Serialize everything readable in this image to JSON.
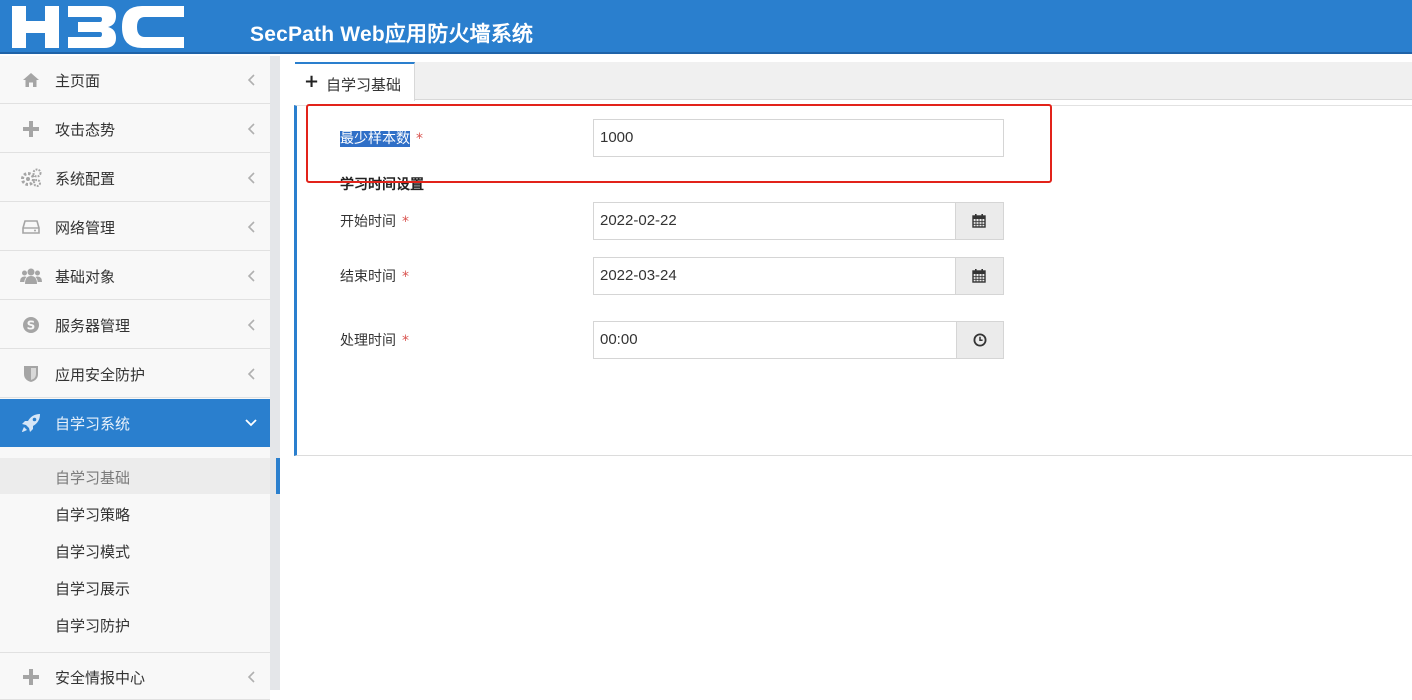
{
  "header": {
    "brand": "H3C",
    "title": "SecPath Web应用防火墙系统"
  },
  "sidebar": {
    "items": [
      {
        "label": "主页面",
        "icon": "home-icon"
      },
      {
        "label": "攻击态势",
        "icon": "plus-icon"
      },
      {
        "label": "系统配置",
        "icon": "gears-icon"
      },
      {
        "label": "网络管理",
        "icon": "hdd-icon"
      },
      {
        "label": "基础对象",
        "icon": "users-icon"
      },
      {
        "label": "服务器管理",
        "icon": "skype-icon"
      },
      {
        "label": "应用安全防护",
        "icon": "shield-icon"
      },
      {
        "label": "自学习系统",
        "icon": "rocket-icon"
      },
      {
        "label": "安全情报中心",
        "icon": "plus-icon"
      }
    ],
    "submenu": [
      "自学习基础",
      "自学习策略",
      "自学习模式",
      "自学习展示",
      "自学习防护"
    ]
  },
  "tab": {
    "label": "自学习基础",
    "icon": "plus-icon"
  },
  "form": {
    "min_samples": {
      "label": "最少样本数",
      "required": "*",
      "value": "1000"
    },
    "section_title": "学习时间设置",
    "start_time": {
      "label": "开始时间",
      "required": "*",
      "value": "2022-02-22",
      "icon": "calendar-icon"
    },
    "end_time": {
      "label": "结束时间",
      "required": "*",
      "value": "2022-03-24",
      "icon": "calendar-icon"
    },
    "process_time": {
      "label": "处理时间",
      "required": "*",
      "value": "00:00",
      "icon": "clock-icon"
    }
  },
  "colors": {
    "accent": "#2a7fce",
    "required": "#d9534f",
    "annotation": "#e2231a"
  }
}
